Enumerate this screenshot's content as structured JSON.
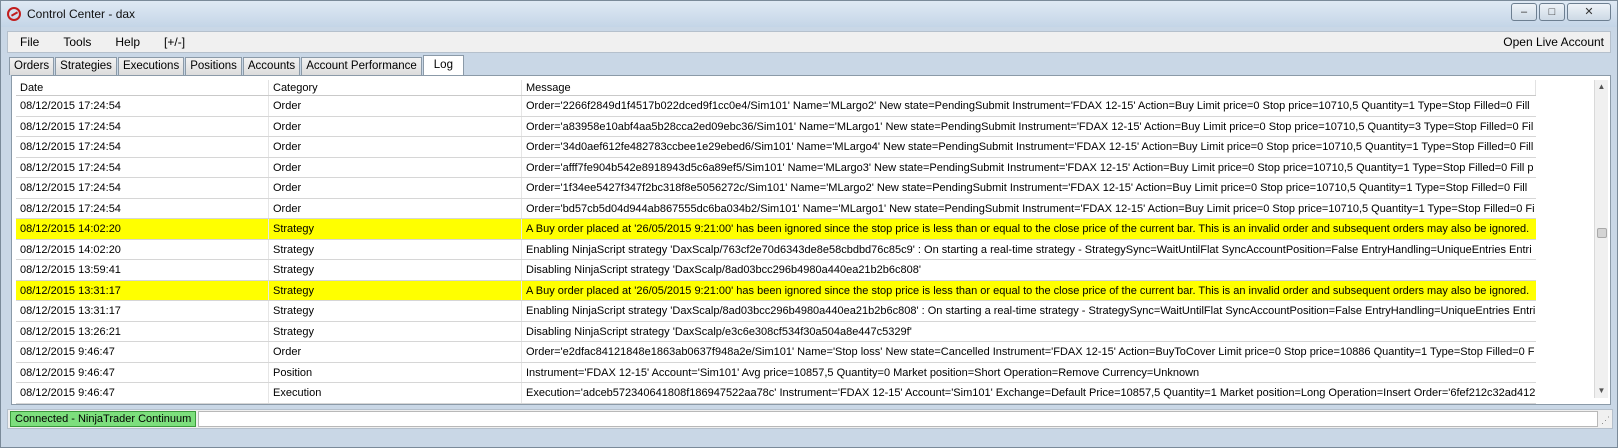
{
  "window": {
    "title": "Control Center - dax",
    "minimize_glyph": "–",
    "maximize_glyph": "□",
    "close_glyph": "✕"
  },
  "menu": {
    "items": [
      "File",
      "Tools",
      "Help",
      "[+/-]"
    ],
    "right_label": "Open Live Account"
  },
  "tabs": [
    "Orders",
    "Strategies",
    "Executions",
    "Positions",
    "Accounts",
    "Account Performance",
    "Log"
  ],
  "active_tab": "Log",
  "log": {
    "headers": [
      "Date",
      "Category",
      "Message"
    ],
    "rows": [
      {
        "date": "08/12/2015 17:24:54",
        "category": "Order",
        "message": "Order='2266f2849d1f4517b022dced9f1cc0e4/Sim101' Name='MLargo2' New state=PendingSubmit Instrument='FDAX 12-15' Action=Buy Limit price=0 Stop price=10710,5 Quantity=1 Type=Stop Filled=0 Fill",
        "highlight": false
      },
      {
        "date": "08/12/2015 17:24:54",
        "category": "Order",
        "message": "Order='a83958e10abf4aa5b28cca2ed09ebc36/Sim101' Name='MLargo1' New state=PendingSubmit Instrument='FDAX 12-15' Action=Buy Limit price=0 Stop price=10710,5 Quantity=3 Type=Stop Filled=0 Fil",
        "highlight": false
      },
      {
        "date": "08/12/2015 17:24:54",
        "category": "Order",
        "message": "Order='34d0aef612fe482783ccbee1e29ebed6/Sim101' Name='MLargo4' New state=PendingSubmit Instrument='FDAX 12-15' Action=Buy Limit price=0 Stop price=10710,5 Quantity=1 Type=Stop Filled=0 Fill",
        "highlight": false
      },
      {
        "date": "08/12/2015 17:24:54",
        "category": "Order",
        "message": "Order='afff7fe904b542e8918943d5c6a89ef5/Sim101' Name='MLargo3' New state=PendingSubmit Instrument='FDAX 12-15' Action=Buy Limit price=0 Stop price=10710,5 Quantity=1 Type=Stop Filled=0 Fill p",
        "highlight": false
      },
      {
        "date": "08/12/2015 17:24:54",
        "category": "Order",
        "message": "Order='1f34ee5427f347f2bc318f8e5056272c/Sim101' Name='MLargo2' New state=PendingSubmit Instrument='FDAX 12-15' Action=Buy Limit price=0 Stop price=10710,5 Quantity=1 Type=Stop Filled=0 Fill",
        "highlight": false
      },
      {
        "date": "08/12/2015 17:24:54",
        "category": "Order",
        "message": "Order='bd57cb5d04d944ab867555dc6ba034b2/Sim101' Name='MLargo1' New state=PendingSubmit Instrument='FDAX 12-15' Action=Buy Limit price=0 Stop price=10710,5 Quantity=1 Type=Stop Filled=0 Fi",
        "highlight": false
      },
      {
        "date": "08/12/2015 14:02:20",
        "category": "Strategy",
        "message": "A Buy order placed at '26/05/2015 9:21:00' has been ignored since the stop price is less than or equal to the close price of the current bar. This is an invalid order and subsequent orders may also be ignored.",
        "highlight": true
      },
      {
        "date": "08/12/2015 14:02:20",
        "category": "Strategy",
        "message": "Enabling NinjaScript strategy 'DaxScalp/763cf2e70d6343de8e58cbdbd76c85c9' : On starting a real-time strategy - StrategySync=WaitUntilFlat SyncAccountPosition=False EntryHandling=UniqueEntries Entri",
        "highlight": false
      },
      {
        "date": "08/12/2015 13:59:41",
        "category": "Strategy",
        "message": "Disabling NinjaScript strategy 'DaxScalp/8ad03bcc296b4980a440ea21b2b6c808'",
        "highlight": false
      },
      {
        "date": "08/12/2015 13:31:17",
        "category": "Strategy",
        "message": "A Buy order placed at '26/05/2015 9:21:00' has been ignored since the stop price is less than or equal to the close price of the current bar. This is an invalid order and subsequent orders may also be ignored.",
        "highlight": true
      },
      {
        "date": "08/12/2015 13:31:17",
        "category": "Strategy",
        "message": "Enabling NinjaScript strategy 'DaxScalp/8ad03bcc296b4980a440ea21b2b6c808' : On starting a real-time strategy - StrategySync=WaitUntilFlat SyncAccountPosition=False EntryHandling=UniqueEntries Entri",
        "highlight": false
      },
      {
        "date": "08/12/2015 13:26:21",
        "category": "Strategy",
        "message": "Disabling NinjaScript strategy 'DaxScalp/e3c6e308cf534f30a504a8e447c5329f'",
        "highlight": false
      },
      {
        "date": "08/12/2015 9:46:47",
        "category": "Order",
        "message": "Order='e2dfac84121848e1863ab0637f948a2e/Sim101' Name='Stop loss' New state=Cancelled Instrument='FDAX 12-15' Action=BuyToCover Limit price=0 Stop price=10886 Quantity=1 Type=Stop Filled=0 F",
        "highlight": false
      },
      {
        "date": "08/12/2015 9:46:47",
        "category": "Position",
        "message": "Instrument='FDAX 12-15' Account='Sim101' Avg price=10857,5 Quantity=0 Market position=Short Operation=Remove Currency=Unknown",
        "highlight": false
      },
      {
        "date": "08/12/2015 9:46:47",
        "category": "Execution",
        "message": "Execution='adceb572340641808f186947522aa78c' Instrument='FDAX 12-15' Account='Sim101' Exchange=Default Price=10857,5 Quantity=1 Market position=Long Operation=Insert Order='6fef212c32ad412",
        "highlight": false
      }
    ]
  },
  "status": {
    "connection": "Connected - NinjaTrader Continuum"
  },
  "colors": {
    "highlight_row": "#ffff00",
    "connected_badge": "#7ddf7d",
    "app_icon": "#c21d1d"
  }
}
